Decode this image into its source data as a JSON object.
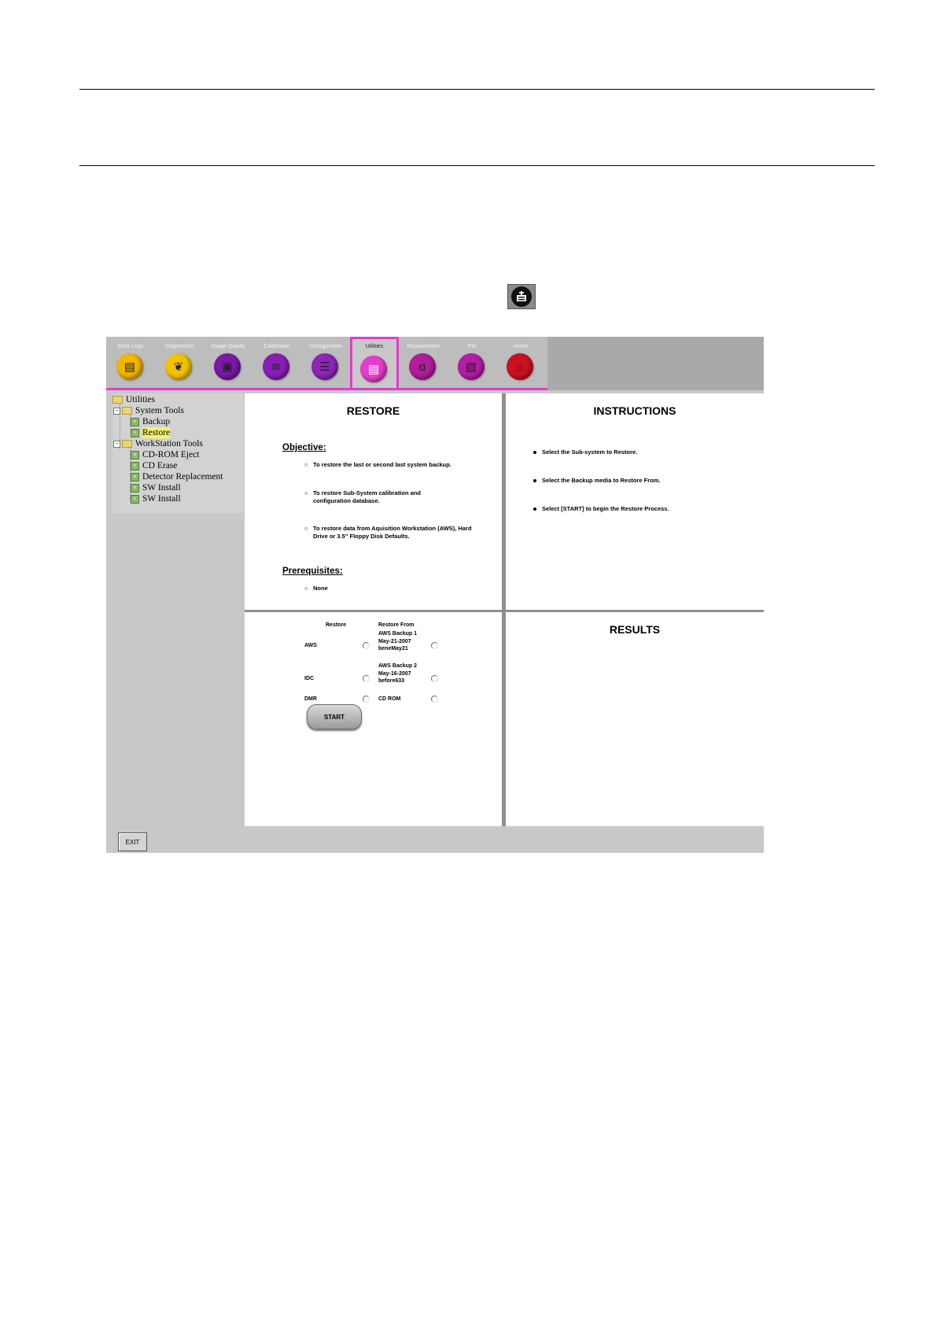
{
  "toolbar": {
    "tabs": [
      {
        "label": "Error Logs",
        "icon": "error-logs-icon",
        "color": "#f2b500",
        "glyph": "▤"
      },
      {
        "label": "Diagnostics",
        "icon": "diagnostics-icon",
        "color": "#f2c200",
        "glyph": "❦"
      },
      {
        "label": "Image Quality",
        "icon": "image-quality-icon",
        "color": "#7a18a8",
        "glyph": "▣"
      },
      {
        "label": "Calibration",
        "icon": "calibration-icon",
        "color": "#8a1cb8",
        "glyph": "≋"
      },
      {
        "label": "Configuration",
        "icon": "configuration-icon",
        "color": "#8e24b8",
        "glyph": "☰"
      },
      {
        "label": "Utilities",
        "icon": "utilities-icon",
        "color": "#e43ccc",
        "glyph": "▤"
      },
      {
        "label": "Replacement",
        "icon": "replacement-icon",
        "color": "#b01c9a",
        "glyph": "ɑ"
      },
      {
        "label": "PM",
        "icon": "pm-icon",
        "color": "#b41ca8",
        "glyph": "▧"
      },
      {
        "label": "Home",
        "icon": "home-icon",
        "color": "#cc1020",
        "glyph": "⌂"
      }
    ],
    "active_tab": "Utilities"
  },
  "tree": {
    "root": "Utilities",
    "system_tools": "System Tools",
    "backup": "Backup",
    "restore": "Restore",
    "workstation_tools": "WorkStation Tools",
    "cdrom_eject": "CD-ROM Eject",
    "cd_erase": "CD Erase",
    "detector_replacement": "Detector Replacement",
    "sw_install_1": "SW Install",
    "sw_install_2": "SW Install",
    "selected": "Restore"
  },
  "restore_panel": {
    "title": "RESTORE",
    "objective_heading": "Objective",
    "objectives": [
      "To restore the last or second last system backup.",
      "To restore Sub-System calibration and configuration database.",
      "To restore data from Aquisition Workstation (AWS), Hard Drive or 3.5\" Floppy Disk Defaults."
    ],
    "prerequisites_heading": "Prerequisites",
    "prerequisites": [
      "None"
    ]
  },
  "instructions_panel": {
    "title": "INSTRUCTIONS",
    "items": [
      "Select the Sub-system to Restore.",
      "Select the Backup media to Restore From.",
      "Select [START] to begin the Restore Process."
    ]
  },
  "form": {
    "restore_header": "Restore",
    "restore_from_header": "Restore From",
    "rows": [
      {
        "subsystem": "AWS",
        "source_line1": "AWS Backup 1",
        "source_line2": "May-21-2007",
        "source_line3": "beneMay21"
      },
      {
        "subsystem": "IDC",
        "source_line1": "AWS Backup 2",
        "source_line2": "May-16-2007",
        "source_line3": "before633"
      },
      {
        "subsystem": "DMR",
        "source_line1": "CD ROM",
        "source_line2": "",
        "source_line3": ""
      }
    ],
    "start_label": "START"
  },
  "results_panel": {
    "title": "RESULTS"
  },
  "exit_label": "EXIT"
}
